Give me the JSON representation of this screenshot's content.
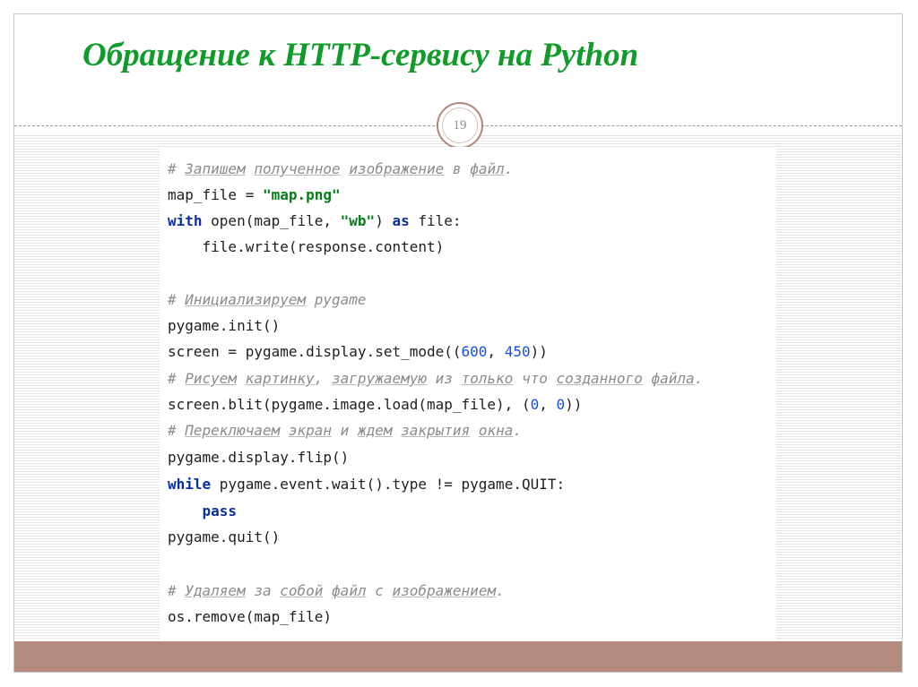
{
  "slide": {
    "title": "Обращение к HTTP-сервису на Python",
    "page_number": "19"
  },
  "colors": {
    "title": "#119b2a",
    "accent_bar": "#b58b80",
    "code_comment": "#8c8c8c",
    "code_keyword": "#0b2f9c",
    "code_string": "#067d17",
    "code_number": "#1750eb"
  },
  "code": {
    "l1": {
      "c_hash": "# ",
      "w1": "Запишем",
      "sp1": " ",
      "w2": "полученное",
      "sp2": " ",
      "w3": "изображение",
      "sp3": " в ",
      "w4": "файл",
      "end": "."
    },
    "l2": {
      "t1": "map_file = ",
      "s1": "\"map.png\""
    },
    "l3": {
      "k1": "with",
      "t1": " open(map_file, ",
      "s1": "\"wb\"",
      "t2": ") ",
      "k2": "as",
      "t3": " file:"
    },
    "l4": {
      "t1": "    file.write(response.content)"
    },
    "l5": {
      "c_hash": "# ",
      "w1": "Инициализируем",
      "end": " pygame"
    },
    "l6": {
      "t1": "pygame.init()"
    },
    "l7": {
      "t1": "screen = pygame.display.set_mode((",
      "n1": "600",
      "t2": ", ",
      "n2": "450",
      "t3": "))"
    },
    "l8": {
      "c_hash": "# ",
      "w1": "Рисуем",
      "sp1": " ",
      "w2": "картинку",
      "sp2": ", ",
      "w3": "загружаемую",
      "sp3": " из ",
      "w4": "только",
      "sp4": " что ",
      "w5": "созданного",
      "sp5": " ",
      "w6": "файла",
      "end": "."
    },
    "l9": {
      "t1": "screen.blit(pygame.image.load(map_file), (",
      "n1": "0",
      "t2": ", ",
      "n2": "0",
      "t3": "))"
    },
    "l10": {
      "c_hash": "# ",
      "w1": "Переключаем",
      "sp1": " ",
      "w2": "экран",
      "sp2": " и ",
      "w3": "ждем",
      "sp3": " ",
      "w4": "закрытия",
      "sp4": " ",
      "w5": "окна",
      "end": "."
    },
    "l11": {
      "t1": "pygame.display.flip()"
    },
    "l12": {
      "k1": "while",
      "t1": " pygame.event.wait().type != pygame.QUIT:"
    },
    "l13": {
      "ind": "    ",
      "k1": "pass"
    },
    "l14": {
      "t1": "pygame.quit()"
    },
    "l15": {
      "c_hash": "# ",
      "w1": "Удаляем",
      "sp1": " за ",
      "w2": "собой",
      "sp2": " ",
      "w3": "файл",
      "sp3": " с ",
      "w4": "изображением",
      "end": "."
    },
    "l16": {
      "t1": "os.remove(map_file)"
    }
  }
}
